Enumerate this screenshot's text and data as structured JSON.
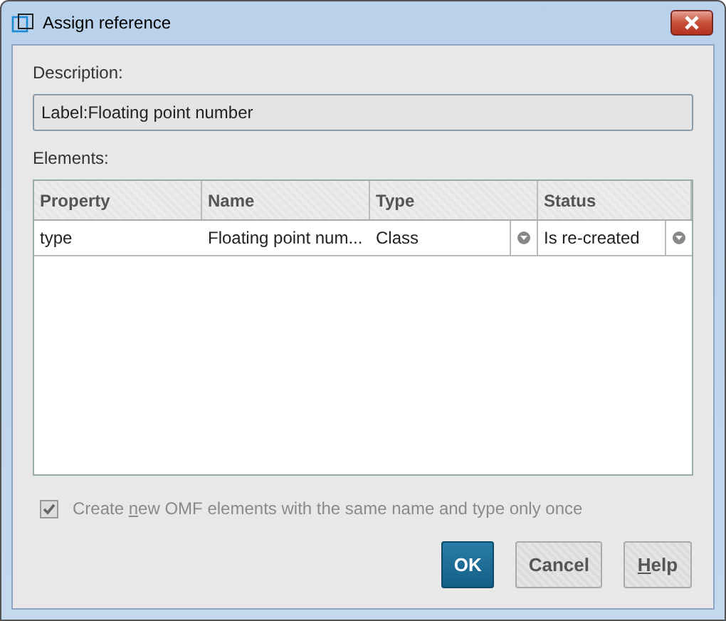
{
  "window": {
    "title": "Assign reference"
  },
  "description": {
    "label": "Description:",
    "value": "Label:Floating point number"
  },
  "elements": {
    "label": "Elements:",
    "columns": [
      "Property",
      "Name",
      "Type",
      "Status"
    ],
    "rows": [
      {
        "property": "type",
        "name": "Floating point num...",
        "type": "Class",
        "status": "Is re-created"
      }
    ]
  },
  "option": {
    "label_before": "Create ",
    "mnemonic": "n",
    "label_after": "ew OMF elements with the same name and type only once",
    "checked": true,
    "disabled": true
  },
  "buttons": [
    {
      "kind": "default",
      "label": "OK"
    },
    {
      "kind": "normal",
      "label": "Cancel"
    },
    {
      "kind": "normal",
      "mnemonic": "H",
      "label": "elp"
    }
  ]
}
